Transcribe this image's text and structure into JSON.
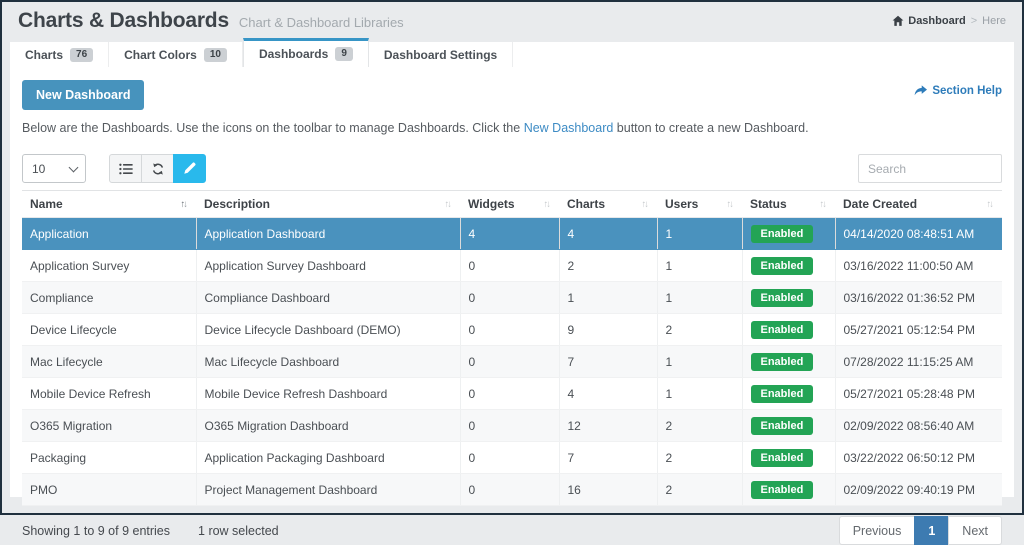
{
  "header": {
    "title": "Charts & Dashboards",
    "subtitle": "Chart & Dashboard Libraries",
    "breadcrumb": {
      "home": "Dashboard",
      "separator": ">",
      "current": "Here"
    }
  },
  "tabs": [
    {
      "label": "Charts",
      "badge": "76",
      "active": false
    },
    {
      "label": "Chart Colors",
      "badge": "10",
      "active": false
    },
    {
      "label": "Dashboards",
      "badge": "9",
      "active": true
    },
    {
      "label": "Dashboard Settings",
      "badge": null,
      "active": false
    }
  ],
  "actions": {
    "new_dashboard_label": "New Dashboard",
    "section_help_label": "Section Help"
  },
  "description": {
    "before": "Below are the Dashboards. Use the icons on the toolbar to manage Dashboards. Click the ",
    "link": "New Dashboard",
    "after": " button to create a new Dashboard."
  },
  "toolbar": {
    "page_size": "10",
    "search_placeholder": "Search",
    "buttons": [
      "list-view",
      "refresh",
      "edit"
    ]
  },
  "table": {
    "columns": [
      "Name",
      "Description",
      "Widgets",
      "Charts",
      "Users",
      "Status",
      "Date Created"
    ],
    "sorted_column": "Name",
    "rows": [
      {
        "name": "Application",
        "description": "Application Dashboard",
        "widgets": "4",
        "charts": "4",
        "users": "1",
        "status": "Enabled",
        "date_created": "04/14/2020 08:48:51 AM",
        "selected": true
      },
      {
        "name": "Application Survey",
        "description": "Application Survey Dashboard",
        "widgets": "0",
        "charts": "2",
        "users": "1",
        "status": "Enabled",
        "date_created": "03/16/2022 11:00:50 AM",
        "selected": false
      },
      {
        "name": "Compliance",
        "description": "Compliance Dashboard",
        "widgets": "0",
        "charts": "1",
        "users": "1",
        "status": "Enabled",
        "date_created": "03/16/2022 01:36:52 PM",
        "selected": false
      },
      {
        "name": "Device Lifecycle",
        "description": "Device Lifecycle Dashboard (DEMO)",
        "widgets": "0",
        "charts": "9",
        "users": "2",
        "status": "Enabled",
        "date_created": "05/27/2021 05:12:54 PM",
        "selected": false
      },
      {
        "name": "Mac Lifecycle",
        "description": "Mac Lifecycle Dashboard",
        "widgets": "0",
        "charts": "7",
        "users": "1",
        "status": "Enabled",
        "date_created": "07/28/2022 11:15:25 AM",
        "selected": false
      },
      {
        "name": "Mobile Device Refresh",
        "description": "Mobile Device Refresh Dashboard",
        "widgets": "0",
        "charts": "4",
        "users": "1",
        "status": "Enabled",
        "date_created": "05/27/2021 05:28:48 PM",
        "selected": false
      },
      {
        "name": "O365 Migration",
        "description": "O365 Migration Dashboard",
        "widgets": "0",
        "charts": "12",
        "users": "2",
        "status": "Enabled",
        "date_created": "02/09/2022 08:56:40 AM",
        "selected": false
      },
      {
        "name": "Packaging",
        "description": "Application Packaging Dashboard",
        "widgets": "0",
        "charts": "7",
        "users": "2",
        "status": "Enabled",
        "date_created": "03/22/2022 06:50:12 PM",
        "selected": false
      },
      {
        "name": "PMO",
        "description": "Project Management Dashboard",
        "widgets": "0",
        "charts": "16",
        "users": "2",
        "status": "Enabled",
        "date_created": "02/09/2022 09:40:19 PM",
        "selected": false
      }
    ]
  },
  "footer": {
    "showing": "Showing 1 to 9 of 9 entries",
    "selected_info": "1 row selected",
    "pagination": {
      "previous": "Previous",
      "current_page": "1",
      "next": "Next"
    }
  },
  "colors": {
    "accent_blue": "#4793bd",
    "tab_active_border": "#3795c6",
    "selected_row_blue": "#4a92be",
    "badge_green": "#23a455",
    "toolbar_active_cyan": "#29b9ec",
    "pagination_active_blue": "#3d7bb1",
    "link_blue": "#3d8bc4"
  }
}
